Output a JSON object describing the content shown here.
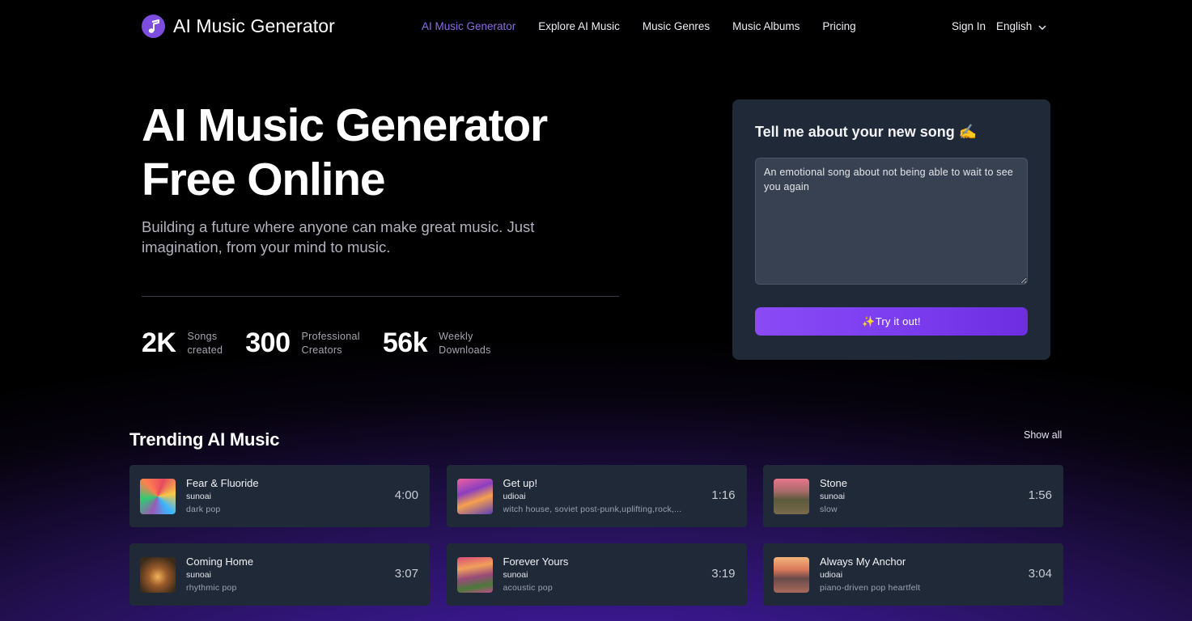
{
  "nav": {
    "brand": "AI Music Generator",
    "links": [
      {
        "label": "AI Music Generator",
        "active": true
      },
      {
        "label": "Explore AI Music",
        "active": false
      },
      {
        "label": "Music Genres",
        "active": false
      },
      {
        "label": "Music Albums",
        "active": false
      },
      {
        "label": "Pricing",
        "active": false
      }
    ],
    "sign_in": "Sign In",
    "language": "English"
  },
  "hero": {
    "title_line1": "AI Music Generator",
    "title_line2": "Free Online",
    "subtitle": "Building a future where anyone can make great music. Just imagination, from your mind to music.",
    "stats": [
      {
        "value": "2K",
        "label_line1": "Songs",
        "label_line2": "created"
      },
      {
        "value": "300",
        "label_line1": "Professional",
        "label_line2": "Creators"
      },
      {
        "value": "56k",
        "label_line1": "Weekly",
        "label_line2": "Downloads"
      }
    ]
  },
  "generator": {
    "title": "Tell me about your new song ✍️",
    "prompt_value": "An emotional song about not being able to wait to see you again",
    "button_label": "✨Try it out!"
  },
  "trending": {
    "title": "Trending AI Music",
    "show_all": "Show all",
    "songs": [
      {
        "title": "Fear & Fluoride",
        "author": "sunoai",
        "tags": "dark pop",
        "duration": "4:00"
      },
      {
        "title": "Get up!",
        "author": "udioai",
        "tags": "witch house, soviet post-punk,uplifting,rock,...",
        "duration": "1:16"
      },
      {
        "title": "Stone",
        "author": "sunoai",
        "tags": "slow",
        "duration": "1:56"
      },
      {
        "title": "Coming Home",
        "author": "sunoai",
        "tags": "rhythmic pop",
        "duration": "3:07"
      },
      {
        "title": "Forever Yours",
        "author": "sunoai",
        "tags": "acoustic pop",
        "duration": "3:19"
      },
      {
        "title": "Always My Anchor",
        "author": "udioai",
        "tags": "piano-driven pop heartfelt",
        "duration": "3:04"
      }
    ]
  },
  "colors": {
    "accent": "#8b6ee6",
    "button_start": "#8a4bf5",
    "button_end": "#6d2ee0",
    "card_bg": "#1f2937"
  }
}
